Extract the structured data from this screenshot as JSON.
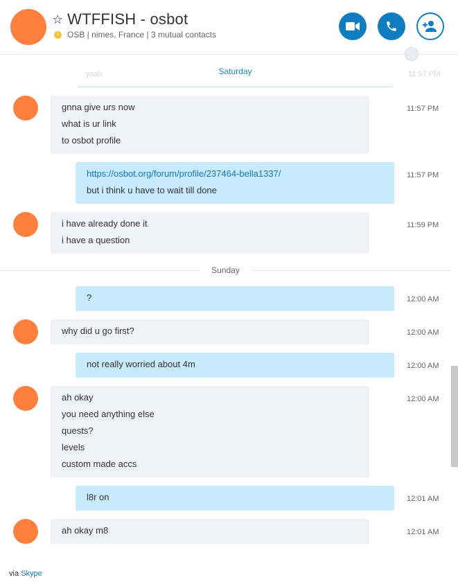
{
  "header": {
    "title": "WTFFISH - osbot",
    "star": "☆",
    "subtitle_group": "OSB",
    "subtitle_location": "nimes, France",
    "subtitle_mutual": "3 mutual contacts"
  },
  "faded": {
    "text": "yeah",
    "time": "11:57 PM"
  },
  "days": {
    "saturday": "Saturday",
    "sunday": "Sunday"
  },
  "messages": [
    {
      "lines": [
        "gnna give urs now",
        "what is ur link",
        "to osbot profile"
      ],
      "time": "11:57 PM"
    },
    {
      "link": "https://osbot.org/forum/profile/237464-bella1337/",
      "lines": [
        "but i think u have to wait till done"
      ],
      "time": "11:57 PM"
    },
    {
      "lines": [
        "i have already done it",
        "i have a question"
      ],
      "time": "11:59 PM"
    },
    {
      "lines": [
        "?"
      ],
      "time": "12:00 AM"
    },
    {
      "lines": [
        "why did u go first?"
      ],
      "time": "12:00 AM"
    },
    {
      "lines": [
        "not really worried about 4m"
      ],
      "time": "12:00 AM"
    },
    {
      "lines": [
        "ah okay",
        "you need anything else",
        "quests?",
        "levels",
        "custom made accs"
      ],
      "time": "12:00 AM"
    },
    {
      "lines": [
        "l8r on"
      ],
      "time": "12:01 AM"
    },
    {
      "lines": [
        "ah okay m8"
      ],
      "time": "12:01 AM"
    }
  ],
  "footer": {
    "via": "via",
    "app": "Skype"
  },
  "colors": {
    "accent": "#0f7dc0",
    "avatar": "#ff7f3f",
    "incoming": "#f1f2f6",
    "outgoing": "#c7ebfb"
  }
}
